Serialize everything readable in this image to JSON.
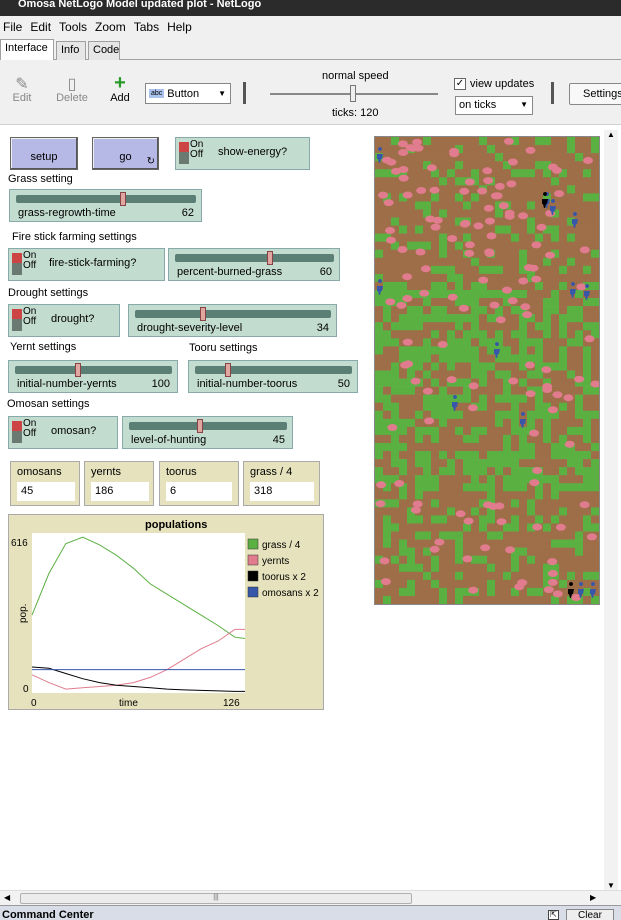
{
  "window": {
    "title": "Omosa NetLogo Model updated plot - NetLogo"
  },
  "menu": [
    "File",
    "Edit",
    "Tools",
    "Zoom",
    "Tabs",
    "Help"
  ],
  "tabs": [
    "Interface",
    "Info",
    "Code"
  ],
  "toolbar": {
    "edit": "Edit",
    "delete": "Delete",
    "add": "Add",
    "widget_type": "Button",
    "speed_label": "normal speed",
    "ticks": "ticks: 120",
    "view_updates": "view updates",
    "update_mode": "on ticks",
    "settings": "Settings..."
  },
  "buttons": {
    "setup": "setup",
    "go": "go"
  },
  "switches": {
    "on": "On",
    "off": "Off",
    "show_energy": "show-energy?",
    "fire_stick": "fire-stick-farming?",
    "drought": "drought?",
    "omosan": "omosan?"
  },
  "sections": {
    "grass": "Grass setting",
    "fire": "Fire stick farming settings",
    "drought": "Drought settings",
    "yernt": "Yernt settings",
    "tooru": "Tooru settings",
    "omosan": "Omosan settings"
  },
  "sliders": [
    {
      "name": "grass-regrowth-time",
      "value": "62",
      "fraction": 0.6
    },
    {
      "name": "percent-burned-grass",
      "value": "60",
      "fraction": 0.6
    },
    {
      "name": "drought-severity-level",
      "value": "34",
      "fraction": 0.34
    },
    {
      "name": "initial-number-yernts",
      "value": "100",
      "fraction": 0.4
    },
    {
      "name": "initial-number-toorus",
      "value": "50",
      "fraction": 0.2
    },
    {
      "name": "level-of-hunting",
      "value": "45",
      "fraction": 0.45
    }
  ],
  "monitors": [
    {
      "label": "omosans",
      "value": "45"
    },
    {
      "label": "yernts",
      "value": "186"
    },
    {
      "label": "toorus",
      "value": "6"
    },
    {
      "label": "grass / 4",
      "value": "318"
    }
  ],
  "colors": {
    "grass": "#5bb042",
    "dirt": "#9d6e48",
    "yernt": "#e07c8e",
    "tooru": "#000000",
    "omosan": "#3857a8"
  },
  "chart_data": {
    "type": "line",
    "title": "populations",
    "xlabel": "time",
    "ylabel": "pop.",
    "xlim": [
      0,
      126
    ],
    "ylim": [
      0,
      616
    ],
    "x_ticks": [
      "0",
      "126"
    ],
    "y_ticks": [
      "0",
      "616"
    ],
    "x": [
      0,
      10,
      20,
      30,
      40,
      50,
      60,
      70,
      80,
      90,
      100,
      110,
      120,
      126
    ],
    "series": [
      {
        "name": "grass / 4",
        "color": "#5bb042",
        "values": [
          300,
          460,
          575,
          600,
          570,
          530,
          480,
          420,
          380,
          340,
          300,
          260,
          215,
          210
        ]
      },
      {
        "name": "yernts",
        "color": "#e07c8e",
        "values": [
          70,
          40,
          15,
          20,
          25,
          30,
          40,
          60,
          90,
          130,
          170,
          200,
          245,
          245
        ]
      },
      {
        "name": "toorus x 2",
        "color": "#000000",
        "values": [
          100,
          95,
          75,
          55,
          40,
          30,
          25,
          20,
          15,
          12,
          10,
          8,
          6,
          6
        ]
      },
      {
        "name": "omosans x 2",
        "color": "#3857a8",
        "values": [
          90,
          90,
          90,
          90,
          90,
          90,
          90,
          90,
          90,
          90,
          90,
          90,
          90,
          90
        ]
      }
    ]
  },
  "command_center": {
    "title": "Command Center",
    "clear": "Clear"
  }
}
